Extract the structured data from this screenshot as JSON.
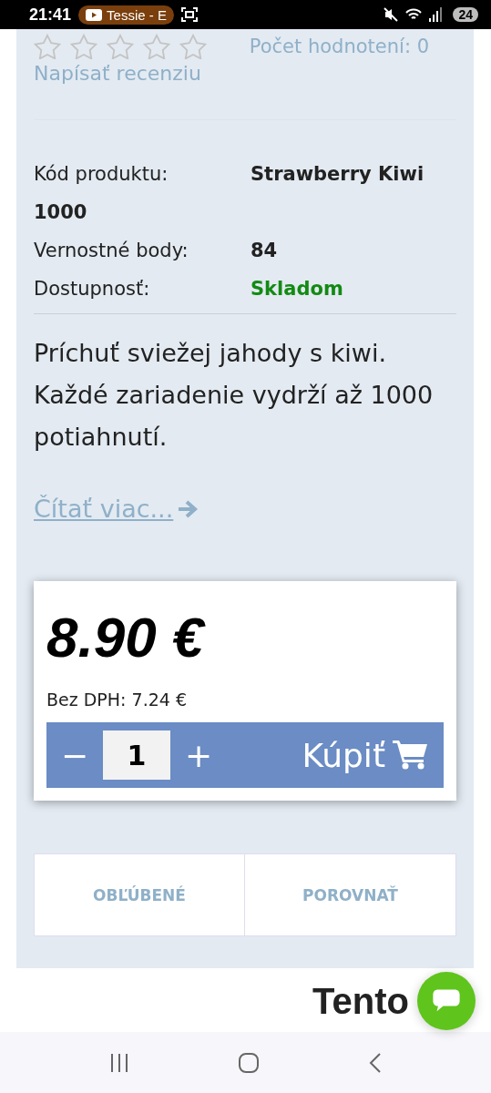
{
  "status_bar": {
    "time": "21:41",
    "media_pill": "Tessie - E",
    "battery": "24"
  },
  "rating": {
    "stars": 0,
    "count_label": "Počet hodnotení: 0"
  },
  "review_link": "Napísať recenziu",
  "details": [
    {
      "label": "Kód produktu:",
      "value": "Strawberry Kiwi 1000",
      "kind": "plain"
    },
    {
      "label": "Vernostné body:",
      "value": "84",
      "kind": "plain"
    },
    {
      "label": "Dostupnosť:",
      "value": "Skladom",
      "kind": "stock"
    }
  ],
  "description": "Príchuť sviežej jahody s kiwi. Každé zariadenie vydrží až 1000 potiahnutí.",
  "read_more": "Čítať viac...",
  "price": {
    "amount": "8.90 €",
    "net": "Bez DPH: 7.24 €"
  },
  "buy_bar": {
    "minus": "−",
    "quantity": "1",
    "plus": "+",
    "button": "Kúpiť"
  },
  "actions": [
    {
      "label": "OBĽÚBENÉ"
    },
    {
      "label": "POROVNAŤ"
    }
  ],
  "footer_heading": "Tento"
}
